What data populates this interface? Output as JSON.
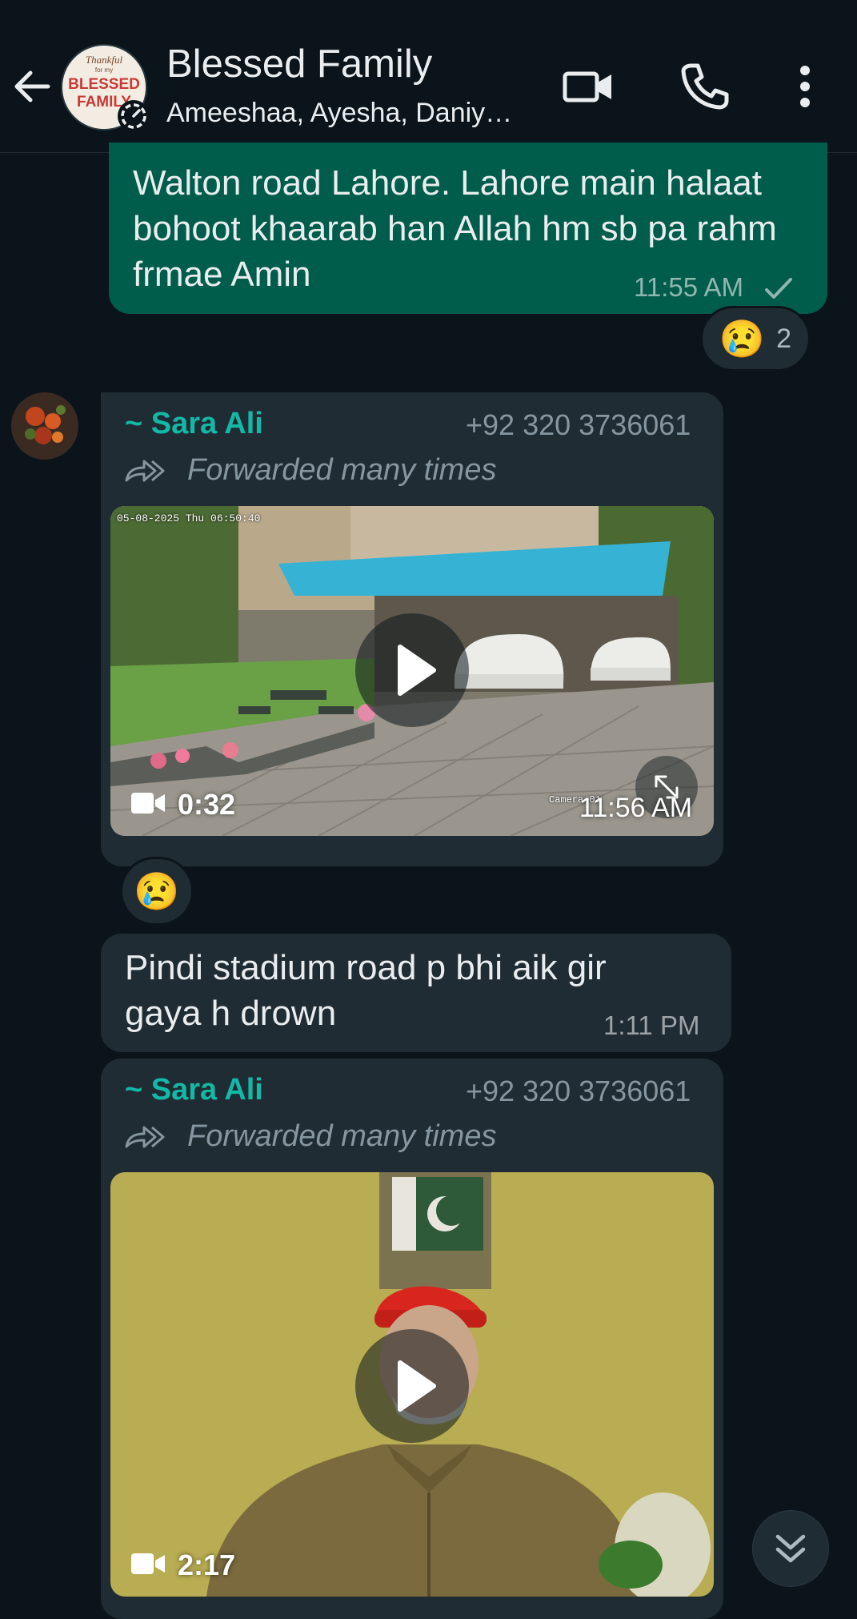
{
  "header": {
    "title": "Blessed Family",
    "subtitle": "Ameeshaa, Ayesha, Daniy…",
    "avatar_lines": [
      "Thankful",
      "for my",
      "BLESSED",
      "FAMILY"
    ]
  },
  "messages": {
    "m1": {
      "text": "Walton road Lahore. Lahore main halaat bohoot khaarab han Allah hm sb pa rahm frmae Amin",
      "time": "11:55 AM",
      "reaction_emoji": "😢",
      "reaction_count": "2"
    },
    "m2": {
      "sender": "~ Sara Ali",
      "phone": "+92 320 3736061",
      "forwarded": "Forwarded many times",
      "cctv_overlay": "05-08-2025 Thu 06:50:40",
      "camera_label": "Camera 01",
      "duration": "0:32",
      "time": "11:56 AM",
      "reaction_emoji": "😢"
    },
    "m3": {
      "text": "Pindi stadium road p bhi aik gir gaya h drown",
      "time": "1:11 PM"
    },
    "m4": {
      "sender": "~ Sara Ali",
      "phone": "+92 320 3736061",
      "forwarded": "Forwarded many times",
      "duration": "2:17"
    }
  },
  "icons": {
    "back": "arrow-left-icon",
    "video_call": "video-camera-icon",
    "voice_call": "phone-icon",
    "menu": "more-vertical-icon",
    "scroll_down": "double-chevron-down-icon"
  },
  "colors": {
    "background": "#0b141a",
    "outgoing_bubble": "#005c4b",
    "incoming_bubble": "#202c33",
    "sender_name": "#14b8a6"
  }
}
